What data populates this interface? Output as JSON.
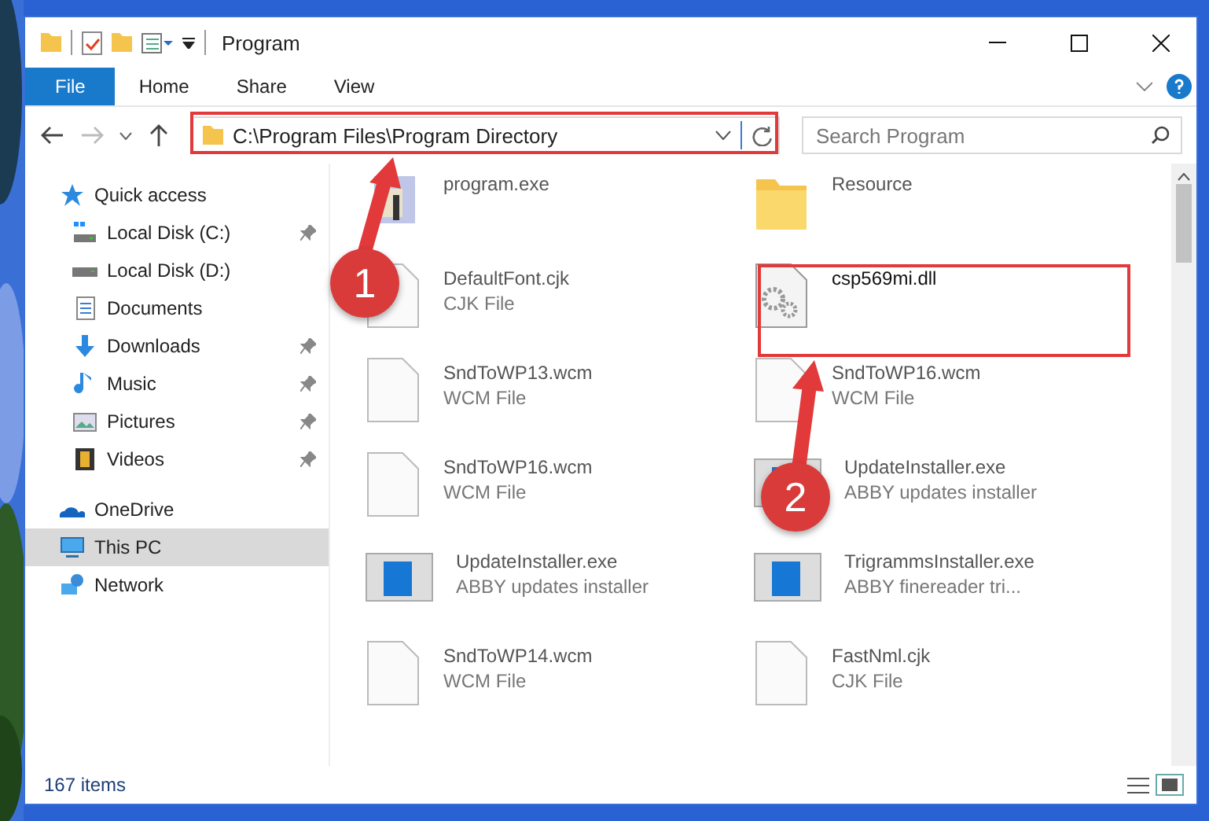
{
  "window": {
    "title": "Program"
  },
  "ribbon_tabs": [
    {
      "label": "File",
      "selected": true
    },
    {
      "label": "Home",
      "selected": false
    },
    {
      "label": "Share",
      "selected": false
    },
    {
      "label": "View",
      "selected": false
    }
  ],
  "address": {
    "path": "C:\\Program Files\\Program Directory"
  },
  "search": {
    "placeholder": "Search Program"
  },
  "sidebar": {
    "items": [
      {
        "label": "Quick access",
        "kind": "star",
        "selected": false,
        "children": [
          {
            "label": "Local Disk (C:)",
            "kind": "drive-windows",
            "pinned": true
          },
          {
            "label": "Local Disk (D:)",
            "kind": "drive",
            "pinned": false
          },
          {
            "label": "Documents",
            "kind": "documents",
            "pinned": false
          },
          {
            "label": "Downloads",
            "kind": "downloads",
            "pinned": true
          },
          {
            "label": "Music",
            "kind": "music",
            "pinned": true
          },
          {
            "label": "Pictures",
            "kind": "pictures",
            "pinned": true
          },
          {
            "label": "Videos",
            "kind": "videos",
            "pinned": true
          }
        ]
      },
      {
        "label": "OneDrive",
        "kind": "cloud",
        "selected": false
      },
      {
        "label": "This PC",
        "kind": "pc",
        "selected": true
      },
      {
        "label": "Network",
        "kind": "network",
        "selected": false
      }
    ]
  },
  "files": [
    {
      "name": "program.exe",
      "kind": "app",
      "highlighted": false
    },
    {
      "name": "Resource",
      "kind": "folder",
      "highlighted": false
    },
    {
      "name": "DefaultFont.cjk",
      "type": "CJK File",
      "kind": "file",
      "highlighted": false
    },
    {
      "name": "csp569mi.dll",
      "kind": "dll",
      "highlighted": true
    },
    {
      "name": "SndToWP13.wcm",
      "type": "WCM File",
      "kind": "file",
      "highlighted": false
    },
    {
      "name": "SndToWP16.wcm",
      "type": "WCM File",
      "kind": "file",
      "highlighted": false
    },
    {
      "name": "SndToWP16.wcm",
      "type": "WCM File",
      "kind": "file",
      "highlighted": false
    },
    {
      "name": "UpdateInstaller.exe",
      "type": "ABBY updates installer",
      "kind": "installer",
      "highlighted": false
    },
    {
      "name": "UpdateInstaller.exe",
      "type": "ABBY updates installer",
      "kind": "installer",
      "highlighted": false
    },
    {
      "name": "TrigrammsInstaller.exe",
      "type": "ABBY finereader tri...",
      "kind": "installer",
      "highlighted": false
    },
    {
      "name": "SndToWP14.wcm",
      "type": "WCM File",
      "kind": "file",
      "highlighted": false
    },
    {
      "name": "FastNml.cjk",
      "type": "CJK File",
      "kind": "file",
      "highlighted": false
    }
  ],
  "status_bar": {
    "count": "167 items"
  },
  "annotations": [
    {
      "number": "1"
    },
    {
      "number": "2"
    }
  ]
}
